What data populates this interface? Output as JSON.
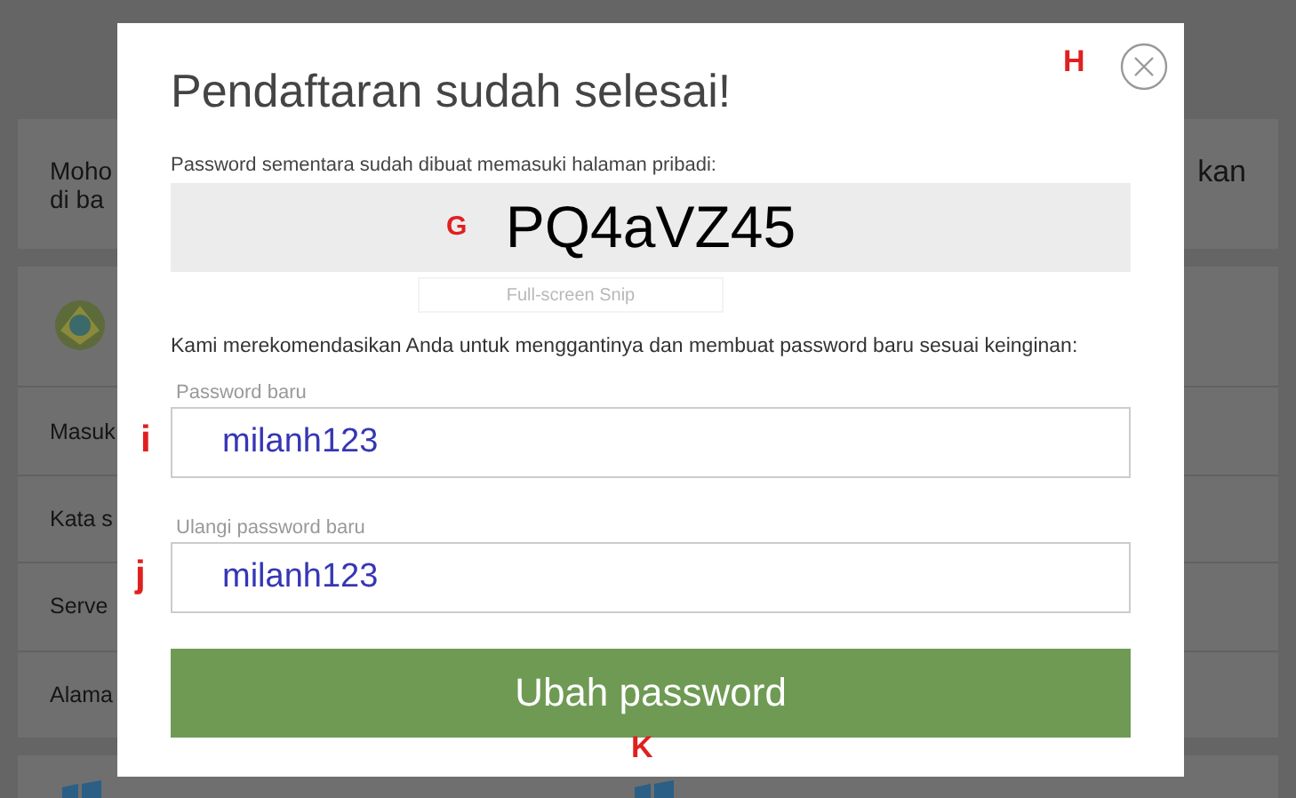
{
  "background": {
    "notice": {
      "lines": [
        "Moho",
        "di ba"
      ],
      "right_fragment": "kan"
    },
    "account_rows": [
      "Masuk",
      "Kata s",
      "Serve",
      "Alama"
    ]
  },
  "dialog": {
    "title": "Pendaftaran sudah selesai!",
    "title_marker": "H",
    "temp_label": "Password sementara sudah dibuat memasuki halaman pribadi:",
    "temp_password": "PQ4aVZ45",
    "temp_marker": "G",
    "snip_ghost": "Full-screen Snip",
    "recommend": "Kami merekomendasikan Anda untuk menggantinya dan membuat password baru sesuai keinginan:",
    "fields": [
      {
        "label": "Password baru",
        "value": "milanh123",
        "marker": "i"
      },
      {
        "label": "Ulangi password baru",
        "value": "milanh123",
        "marker": "j"
      }
    ],
    "submit": {
      "label": "Ubah password",
      "marker": "K"
    }
  }
}
